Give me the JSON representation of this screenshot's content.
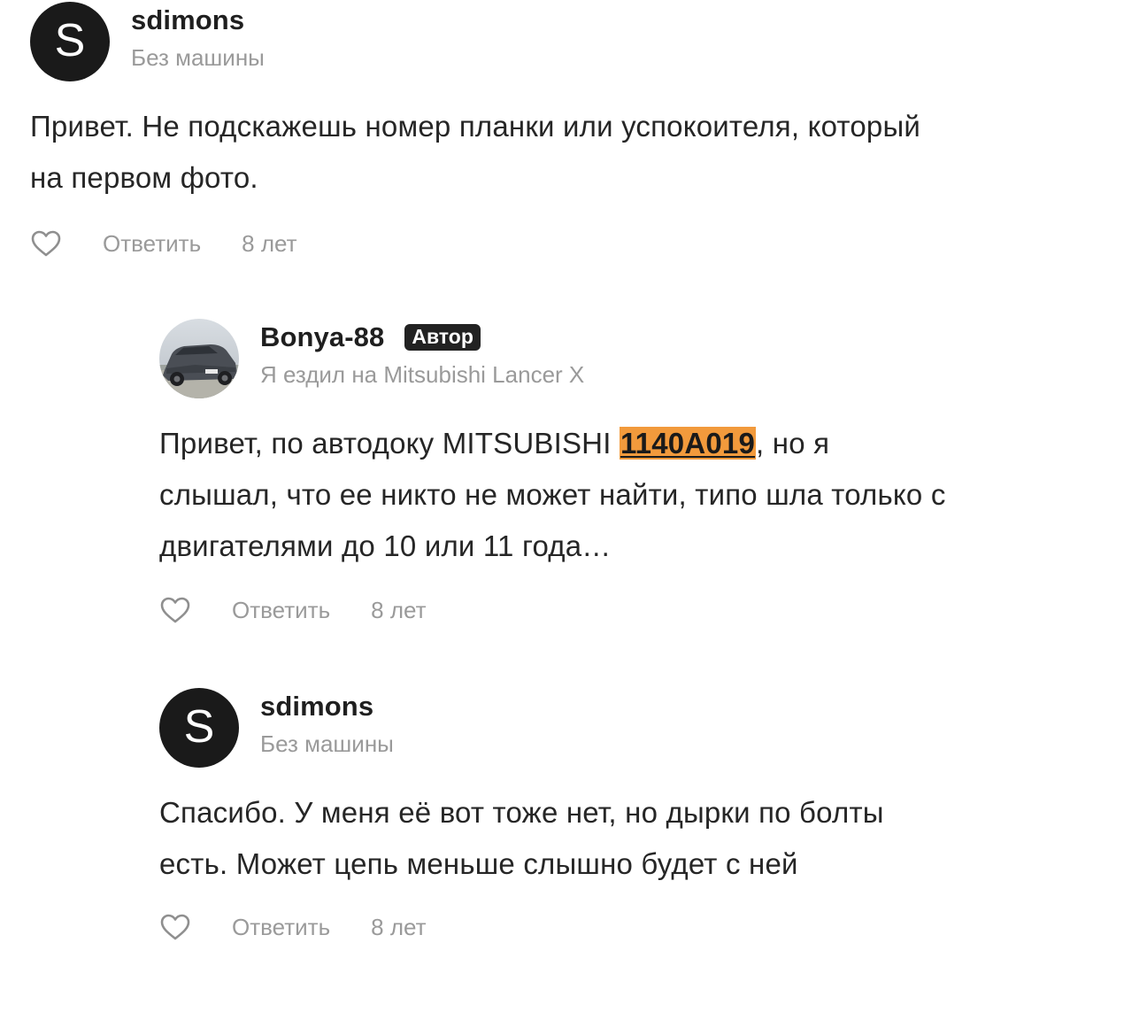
{
  "comments": [
    {
      "author": "sdimons",
      "avatar_letter": "S",
      "car": "Без машины",
      "text": "Привет. Не подскажешь номер планки или успокоителя, который на первом фото.",
      "reply_label": "Ответить",
      "time": "8 лет",
      "like_icon": "heart-outline-icon"
    },
    {
      "author": "Bonya-88",
      "badge": "Автор",
      "car": "Я ездил на Mitsubishi Lancer X",
      "text_before": "Привет, по автодоку MITSUBISHI ",
      "text_highlight": "1140A019",
      "text_after": ", но я слышал, что ее никто не может найти, типо шла только с двигателями до 10 или 11 года…",
      "reply_label": "Ответить",
      "time": "8 лет",
      "like_icon": "heart-outline-icon",
      "highlight_color": "#f29a3c"
    },
    {
      "author": "sdimons",
      "avatar_letter": "S",
      "car": "Без машины",
      "text": "Спасибо. У меня её вот тоже нет, но дырки по болты есть. Может цепь меньше слышно будет с ней",
      "reply_label": "Ответить",
      "time": "8 лет",
      "like_icon": "heart-outline-icon"
    }
  ]
}
